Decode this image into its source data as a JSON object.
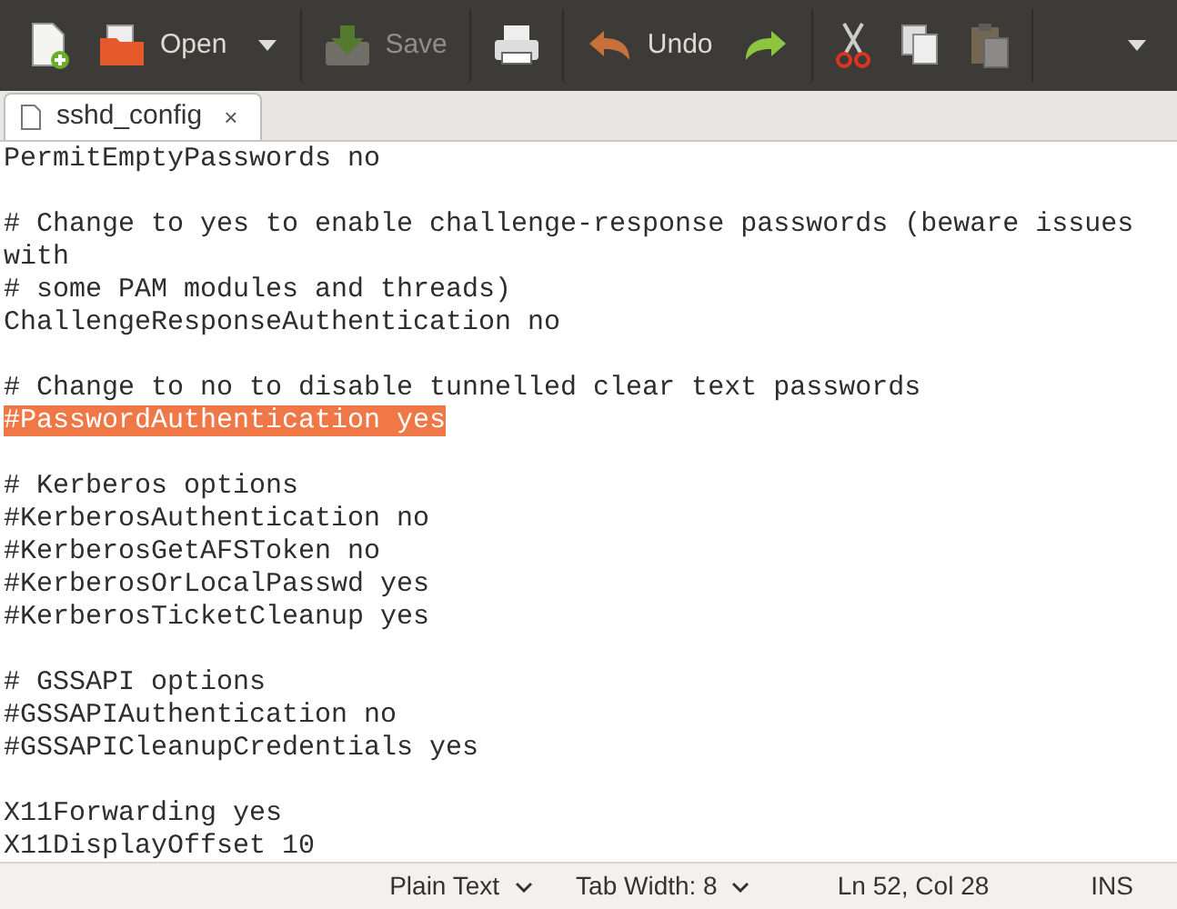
{
  "toolbar": [
    {
      "kind": "new",
      "disabled": false
    },
    {
      "kind": "open",
      "label": "Open",
      "disabled": false
    },
    {
      "kind": "menu",
      "disabled": false
    },
    {
      "kind": "save",
      "label": "Save",
      "disabled": true
    },
    {
      "kind": "print",
      "disabled": false
    },
    {
      "kind": "undo",
      "label": "Undo",
      "disabled": false
    },
    {
      "kind": "redo",
      "disabled": false
    },
    {
      "kind": "cut",
      "disabled": false
    },
    {
      "kind": "copy",
      "disabled": false
    },
    {
      "kind": "paste",
      "disabled": true
    },
    {
      "kind": "overflow",
      "disabled": false
    }
  ],
  "tabs": [
    {
      "title": "sshd_config",
      "close": "×",
      "selected": true
    }
  ],
  "lines": [
    {
      "text": "PermitEmptyPasswords no",
      "highlighted": false
    },
    {
      "kind": "blank"
    },
    {
      "text": "# Change to yes to enable challenge-response passwords (beware issues with",
      "highlighted": false
    },
    {
      "text": "# some PAM modules and threads)",
      "highlighted": false
    },
    {
      "text": "ChallengeResponseAuthentication no",
      "highlighted": false
    },
    {
      "kind": "blank"
    },
    {
      "text": "# Change to no to disable tunnelled clear text passwords",
      "highlighted": false
    },
    {
      "text": "#PasswordAuthentication yes",
      "highlighted": true
    },
    {
      "kind": "blank"
    },
    {
      "text": "# Kerberos options",
      "highlighted": false
    },
    {
      "text": "#KerberosAuthentication no",
      "highlighted": false
    },
    {
      "text": "#KerberosGetAFSToken no",
      "highlighted": false
    },
    {
      "text": "#KerberosOrLocalPasswd yes",
      "highlighted": false
    },
    {
      "text": "#KerberosTicketCleanup yes",
      "highlighted": false
    },
    {
      "kind": "blank"
    },
    {
      "text": "# GSSAPI options",
      "highlighted": false
    },
    {
      "text": "#GSSAPIAuthentication no",
      "highlighted": false
    },
    {
      "text": "#GSSAPICleanupCredentials yes",
      "highlighted": false
    },
    {
      "kind": "blank"
    },
    {
      "text": "X11Forwarding yes",
      "highlighted": false
    },
    {
      "text": "X11DisplayOffset 10",
      "highlighted": false
    }
  ],
  "status_bar": {
    "language": "Plain Text",
    "tab_width": "Tab Width: 8",
    "position": "Ln 52, Col 28",
    "mode": "INS"
  }
}
